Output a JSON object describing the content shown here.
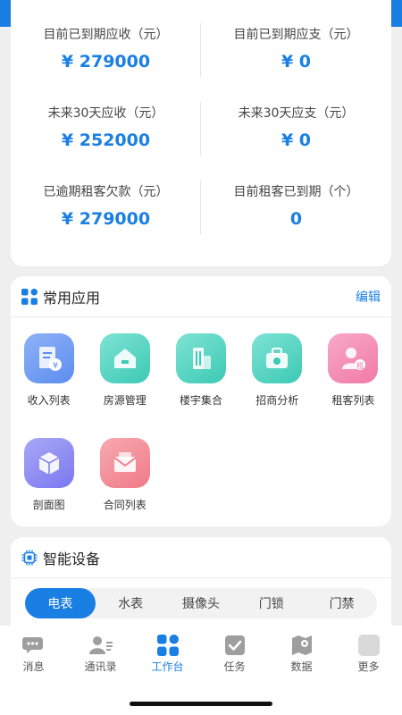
{
  "colors": {
    "accent": "#1a7fe3",
    "background": "#efefef"
  },
  "stats": [
    {
      "label": "目前已到期应收（元）",
      "value": "¥ 279000"
    },
    {
      "label": "目前已到期应支（元）",
      "value": "¥ 0"
    },
    {
      "label": "未来30天应收（元）",
      "value": "¥ 252000"
    },
    {
      "label": "未来30天应支（元）",
      "value": "¥ 0"
    },
    {
      "label": "已逾期租客欠款（元）",
      "value": "¥ 279000"
    },
    {
      "label": "目前租客已到期（个）",
      "value": "0"
    }
  ],
  "apps": {
    "title": "常用应用",
    "edit_label": "编辑",
    "items": [
      {
        "label": "收入列表",
        "icon": "receipt-icon",
        "color": "#5b8def"
      },
      {
        "label": "房源管理",
        "icon": "house-icon",
        "color": "#3cc9b5"
      },
      {
        "label": "楼宇集合",
        "icon": "building-icon",
        "color": "#3cc9b5"
      },
      {
        "label": "招商分析",
        "icon": "briefcase-icon",
        "color": "#3cc9b5"
      },
      {
        "label": "租客列表",
        "icon": "tenant-icon",
        "color": "#f07aa6"
      },
      {
        "label": "剖面图",
        "icon": "cube-icon",
        "color": "#7a78ef"
      },
      {
        "label": "合同列表",
        "icon": "envelope-icon",
        "color": "#f07a86"
      }
    ]
  },
  "devices": {
    "title": "智能设备",
    "tabs": [
      "电表",
      "水表",
      "摄像头",
      "门锁",
      "门禁"
    ],
    "active_tab": "电表"
  },
  "tabbar": {
    "items": [
      {
        "label": "消息",
        "icon": "chat-icon"
      },
      {
        "label": "通讯录",
        "icon": "contacts-icon"
      },
      {
        "label": "工作台",
        "icon": "workbench-icon"
      },
      {
        "label": "任务",
        "icon": "task-icon"
      },
      {
        "label": "数据",
        "icon": "data-icon"
      },
      {
        "label": "更多",
        "icon": "more-icon"
      }
    ],
    "active": "工作台"
  }
}
